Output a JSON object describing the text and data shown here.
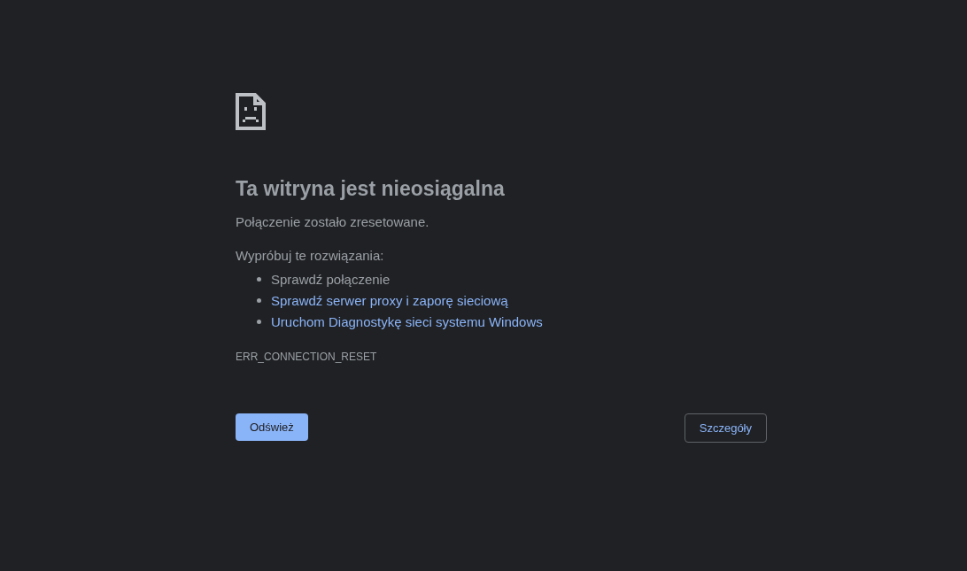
{
  "heading": "Ta witryna jest nieosiągalna",
  "message": "Połączenie zostało zresetowane.",
  "suggestions_intro": "Wypróbuj te rozwiązania:",
  "suggestions": [
    {
      "kind": "text",
      "label": "Sprawdź połączenie"
    },
    {
      "kind": "link",
      "label": "Sprawdź serwer proxy i zaporę sieciową"
    },
    {
      "kind": "link",
      "label": "Uruchom Diagnostykę sieci systemu Windows"
    }
  ],
  "error_code": "ERR_CONNECTION_RESET",
  "buttons": [
    {
      "kind": "primary",
      "label": "Odśwież"
    },
    {
      "kind": "secondary",
      "label": "Szczegóły"
    }
  ]
}
